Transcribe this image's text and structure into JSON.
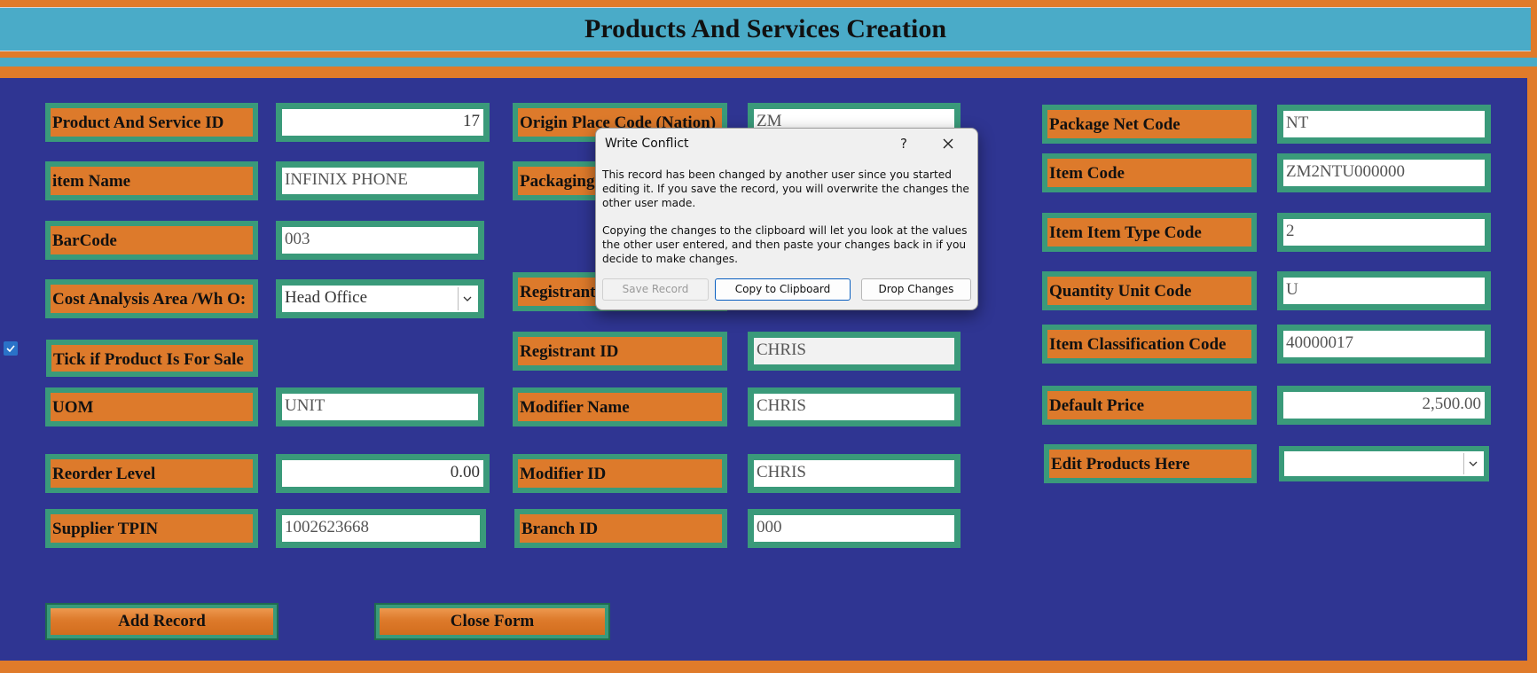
{
  "header": {
    "title": "Products And Services Creation"
  },
  "left_column": {
    "product_id": {
      "label": "Product And Service ID",
      "value": "17"
    },
    "item_name": {
      "label": "item Name",
      "value": "INFINIX PHONE"
    },
    "barcode": {
      "label": "BarCode",
      "value": "003"
    },
    "cost_area": {
      "label": "Cost Analysis Area /Wh O:",
      "value": "Head Office"
    },
    "for_sale": {
      "label": "Tick if Product Is For Sale",
      "checked": true
    },
    "uom": {
      "label": "UOM",
      "value": "UNIT"
    },
    "reorder": {
      "label": "Reorder Level",
      "value": "0.00"
    },
    "supplier_tpin": {
      "label": "Supplier TPIN",
      "value": "1002623668"
    }
  },
  "middle_column": {
    "origin": {
      "label": "Origin Place Code (Nation)",
      "value": "ZM"
    },
    "packaging": {
      "label": "Packaging"
    },
    "registrant": {
      "label": "Registrant"
    },
    "registrant_id": {
      "label": "Registrant ID",
      "value": "CHRIS"
    },
    "modifier_name": {
      "label": "Modifier Name",
      "value": "CHRIS"
    },
    "modifier_id": {
      "label": "Modifier ID",
      "value": "CHRIS"
    },
    "branch_id": {
      "label": "Branch ID",
      "value": "000"
    }
  },
  "right_column": {
    "package_net": {
      "label": "Package Net Code",
      "value": "NT"
    },
    "item_code": {
      "label": "Item Code",
      "value": "ZM2NTU000000"
    },
    "item_type": {
      "label": "Item Item Type Code",
      "value": "2"
    },
    "qty_unit": {
      "label": "Quantity Unit Code",
      "value": "U"
    },
    "item_class": {
      "label": "Item Classification Code",
      "value": "40000017"
    },
    "default_price": {
      "label": "Default Price",
      "value": "2,500.00"
    },
    "edit_products": {
      "label": "Edit Products Here",
      "value": ""
    }
  },
  "buttons": {
    "add_record": "Add Record",
    "close_form": "Close Form"
  },
  "dialog": {
    "title": "Write Conflict",
    "help": "?",
    "message1": "This record has been changed by another user since you started editing it.  If you save the record, you will overwrite the changes the other user made.",
    "message2": "Copying the changes to the clipboard will let you look at the values the other user entered, and then paste your changes back in if you decide to make changes.",
    "save_record": "Save Record",
    "copy_clipboard": "Copy to Clipboard",
    "drop_changes": "Drop Changes"
  },
  "icons": {
    "checkbox": "checkmark-icon",
    "combo": "chevron-down-icon",
    "close": "close-icon"
  },
  "colors": {
    "panel": "#2f3592",
    "accent_orange": "#dd7a2b",
    "border_green": "#3a9a7a",
    "header_blue": "#4aabc8"
  }
}
